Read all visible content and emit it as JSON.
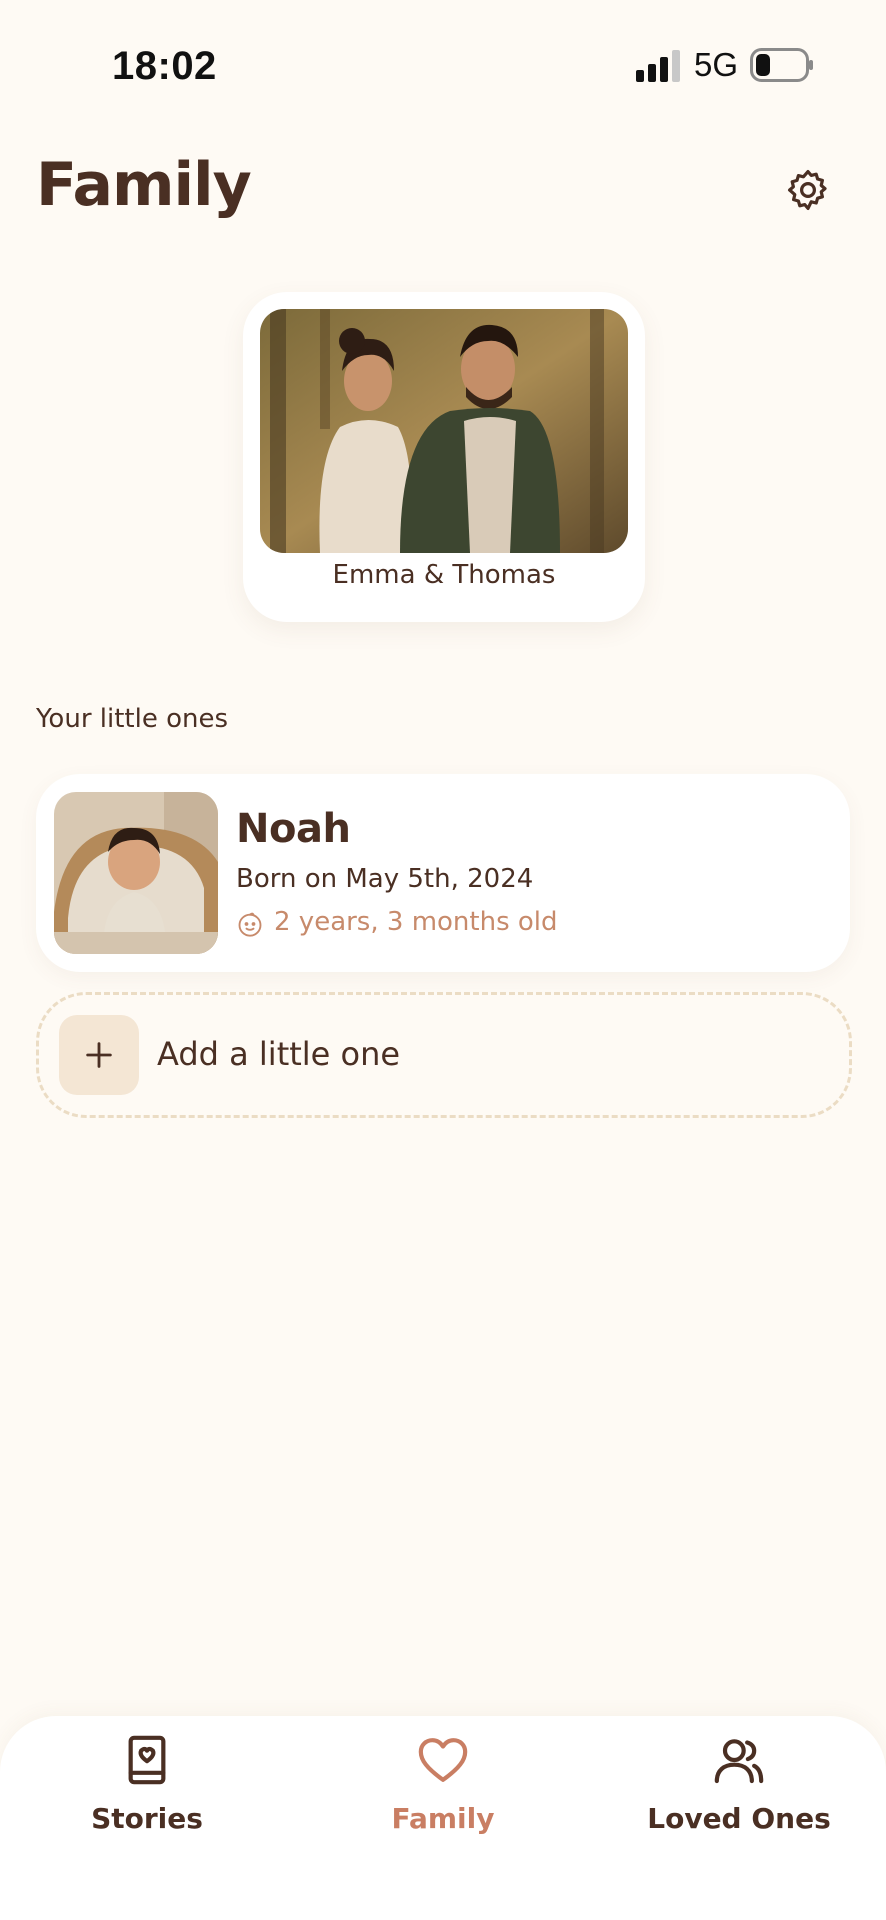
{
  "status_bar": {
    "time": "18:02",
    "network": "5G"
  },
  "header": {
    "title": "Family",
    "settings_icon": "gear-icon"
  },
  "parents": {
    "name": "Emma & Thomas",
    "photo": "couple-photo"
  },
  "children_section": {
    "label": "Your little ones",
    "children": [
      {
        "name": "Noah",
        "born": "Born on May 5th, 2024",
        "age": "2 years, 3 months old",
        "photo": "baby-photo",
        "age_icon": "baby-face-icon"
      }
    ],
    "add_label": "Add a little one",
    "add_icon": "plus-icon"
  },
  "bottom_nav": {
    "items": [
      {
        "label": "Stories",
        "icon": "book-heart-icon",
        "active": false
      },
      {
        "label": "Family",
        "icon": "heart-icon",
        "active": true
      },
      {
        "label": "Loved Ones",
        "icon": "users-icon",
        "active": false
      }
    ]
  },
  "colors": {
    "background": "#fefaf4",
    "text_primary": "#4a2f23",
    "accent": "#c97e63",
    "age_text": "#c78a6b",
    "add_tile": "#f4e6d4",
    "dashed_border": "#ebdcc4"
  }
}
